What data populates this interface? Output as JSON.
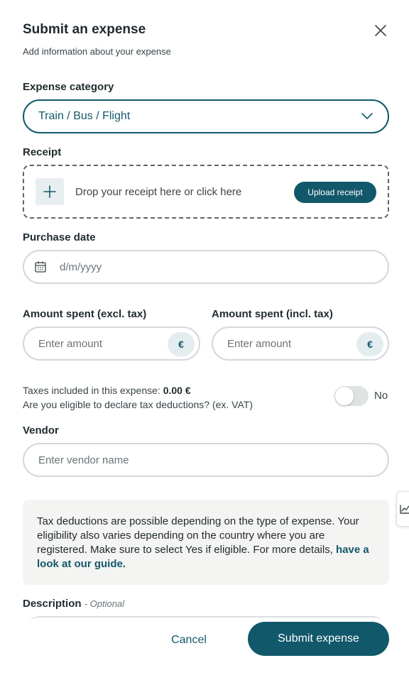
{
  "modal": {
    "title": "Submit an expense",
    "subtitle": "Add information about your expense",
    "close_icon": "close-icon"
  },
  "category": {
    "label": "Expense category",
    "value": "Train / Bus / Flight",
    "icon": "chevron-down-icon"
  },
  "receipt": {
    "label": "Receipt",
    "drop_text": "Drop your receipt here or click here",
    "upload_label": "Upload receipt",
    "icon": "plus-icon"
  },
  "purchase_date": {
    "label": "Purchase date",
    "placeholder": "d/m/yyyy",
    "icon": "calendar-icon"
  },
  "amount_excl": {
    "label": "Amount spent (excl. tax)",
    "placeholder": "Enter amount",
    "currency": "€"
  },
  "amount_incl": {
    "label": "Amount spent (incl. tax)",
    "placeholder": "Enter amount",
    "currency": "€"
  },
  "taxes": {
    "prefix": "Taxes included in this expense: ",
    "amount": "0.00 €",
    "eligible_question": "Are you eligible to declare tax deductions? (ex. VAT)",
    "toggle_label": "No",
    "toggle_on": false
  },
  "vendor": {
    "label": "Vendor",
    "placeholder": "Enter vendor name"
  },
  "info": {
    "text": "Tax deductions are possible depending on the type of expense. Your eligibility also varies depending on the country where you are registered. Make sure to select Yes if eligible. For more details, ",
    "link": "have a look at our guide."
  },
  "description": {
    "label": "Description",
    "optional": "- Optional"
  },
  "footer": {
    "cancel_label": "Cancel",
    "submit_label": "Submit expense"
  },
  "colors": {
    "accent": "#12586b",
    "border": "#d4d8da",
    "info_bg": "#f4f4f2"
  }
}
